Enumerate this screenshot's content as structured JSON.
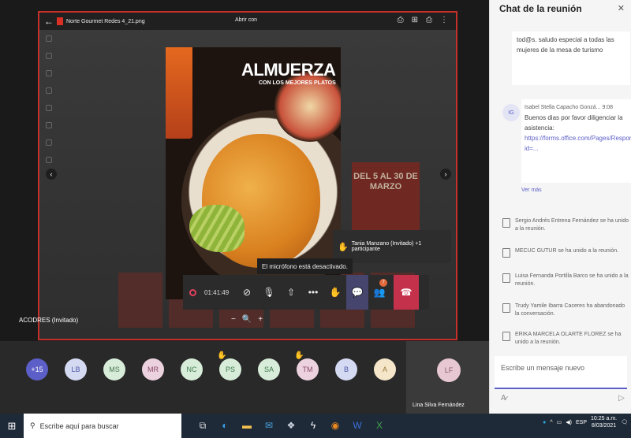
{
  "viewer": {
    "file_name": "Norte Gourmet Redes 4_21.png",
    "owner": "Abrir con",
    "tools": [
      "⎙",
      "⊞",
      "⎙",
      "⋮"
    ]
  },
  "poster": {
    "title": "ALMUERZA",
    "subtitle": "CON LOS MEJORES PLATOS",
    "side_promo": "DEL 5 AL 30\nDE MARZO"
  },
  "toast": {
    "text": "Tania Manzano (Invitado) +1 participante"
  },
  "mic_tooltip": "El micrófono está desactivado.",
  "call": {
    "timer": "01:41:49",
    "badge": "7"
  },
  "presenter": "ACODRES (Invitado)",
  "participants": [
    {
      "initials": "+15",
      "bg": "#5b5fc7",
      "fg": "#ffffff",
      "hand": false
    },
    {
      "initials": "LB",
      "bg": "#d5daf3",
      "fg": "#4d56a3",
      "hand": false
    },
    {
      "initials": "MS",
      "bg": "#d7ecd9",
      "fg": "#4a7a52",
      "hand": false
    },
    {
      "initials": "MR",
      "bg": "#ecd2df",
      "fg": "#8a4a6a",
      "hand": false
    },
    {
      "initials": "NC",
      "bg": "#d7ecd9",
      "fg": "#3d7a4a",
      "hand": false
    },
    {
      "initials": "PS",
      "bg": "#d7ecd9",
      "fg": "#3d7a4a",
      "hand": true
    },
    {
      "initials": "SA",
      "bg": "#d7ecd9",
      "fg": "#3d7a4a",
      "hand": false
    },
    {
      "initials": "TM",
      "bg": "#ecd2df",
      "fg": "#8a4a6a",
      "hand": true
    },
    {
      "initials": "B",
      "bg": "#d5daf3",
      "fg": "#4d56a3",
      "hand": false
    },
    {
      "initials": "A",
      "bg": "#f5e6c9",
      "fg": "#9a7a3a",
      "hand": false
    }
  ],
  "self": {
    "initials": "LF",
    "name": "Lina Silva Fernández"
  },
  "chat": {
    "title": "Chat de la reunión",
    "msg1": "tod@s. saludo especial a todas las mujeres de la mesa de turismo",
    "msg2_initials": "IG",
    "msg2_sender": "Isabel Stella Capacho Gonzá...  9:08",
    "msg2_text": "Buenos dias por favor diligenciar la asistencia:",
    "msg2_link": "https://forms.office.com/Pages/ResponsePage.aspx?id=...",
    "ver_mas": "Ver más",
    "system": [
      "Sergio Andrés Entrena Fernández se ha unido a la reunión.",
      "MECUC GUTUR se ha unido a la reunión.",
      "Luisa Fernanda Portilla Barco se ha unido a la reunión.",
      "Trudy Yamile Ibarra Caceres ha abandonado la conversación.",
      "ERIKA MARCELA OLARTE FLOREZ se ha unido a la reunión."
    ],
    "compose_placeholder": "Escribe un mensaje nuevo"
  },
  "taskbar": {
    "search_placeholder": "Escribe aquí para buscar",
    "lang": "ESP",
    "time": "10:25 a.m.",
    "date": "8/03/2021"
  }
}
